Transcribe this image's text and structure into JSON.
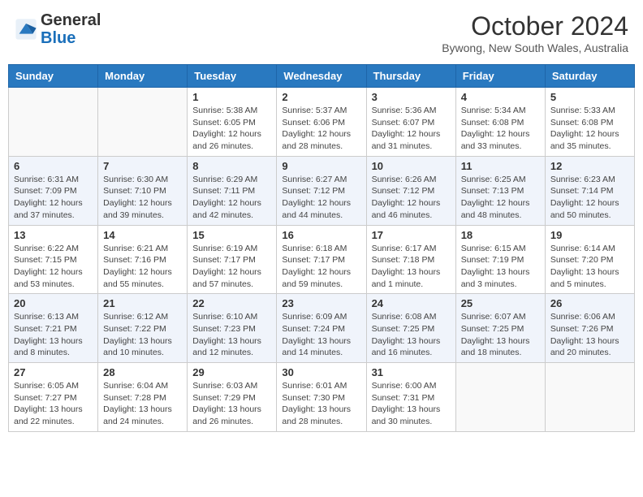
{
  "header": {
    "logo": {
      "general": "General",
      "blue": "Blue"
    },
    "title": "October 2024",
    "subtitle": "Bywong, New South Wales, Australia"
  },
  "days_of_week": [
    "Sunday",
    "Monday",
    "Tuesday",
    "Wednesday",
    "Thursday",
    "Friday",
    "Saturday"
  ],
  "weeks": [
    [
      {
        "day": "",
        "info": ""
      },
      {
        "day": "",
        "info": ""
      },
      {
        "day": "1",
        "sunrise": "Sunrise: 5:38 AM",
        "sunset": "Sunset: 6:05 PM",
        "daylight": "Daylight: 12 hours and 26 minutes."
      },
      {
        "day": "2",
        "sunrise": "Sunrise: 5:37 AM",
        "sunset": "Sunset: 6:06 PM",
        "daylight": "Daylight: 12 hours and 28 minutes."
      },
      {
        "day": "3",
        "sunrise": "Sunrise: 5:36 AM",
        "sunset": "Sunset: 6:07 PM",
        "daylight": "Daylight: 12 hours and 31 minutes."
      },
      {
        "day": "4",
        "sunrise": "Sunrise: 5:34 AM",
        "sunset": "Sunset: 6:08 PM",
        "daylight": "Daylight: 12 hours and 33 minutes."
      },
      {
        "day": "5",
        "sunrise": "Sunrise: 5:33 AM",
        "sunset": "Sunset: 6:08 PM",
        "daylight": "Daylight: 12 hours and 35 minutes."
      }
    ],
    [
      {
        "day": "6",
        "sunrise": "Sunrise: 6:31 AM",
        "sunset": "Sunset: 7:09 PM",
        "daylight": "Daylight: 12 hours and 37 minutes."
      },
      {
        "day": "7",
        "sunrise": "Sunrise: 6:30 AM",
        "sunset": "Sunset: 7:10 PM",
        "daylight": "Daylight: 12 hours and 39 minutes."
      },
      {
        "day": "8",
        "sunrise": "Sunrise: 6:29 AM",
        "sunset": "Sunset: 7:11 PM",
        "daylight": "Daylight: 12 hours and 42 minutes."
      },
      {
        "day": "9",
        "sunrise": "Sunrise: 6:27 AM",
        "sunset": "Sunset: 7:12 PM",
        "daylight": "Daylight: 12 hours and 44 minutes."
      },
      {
        "day": "10",
        "sunrise": "Sunrise: 6:26 AM",
        "sunset": "Sunset: 7:12 PM",
        "daylight": "Daylight: 12 hours and 46 minutes."
      },
      {
        "day": "11",
        "sunrise": "Sunrise: 6:25 AM",
        "sunset": "Sunset: 7:13 PM",
        "daylight": "Daylight: 12 hours and 48 minutes."
      },
      {
        "day": "12",
        "sunrise": "Sunrise: 6:23 AM",
        "sunset": "Sunset: 7:14 PM",
        "daylight": "Daylight: 12 hours and 50 minutes."
      }
    ],
    [
      {
        "day": "13",
        "sunrise": "Sunrise: 6:22 AM",
        "sunset": "Sunset: 7:15 PM",
        "daylight": "Daylight: 12 hours and 53 minutes."
      },
      {
        "day": "14",
        "sunrise": "Sunrise: 6:21 AM",
        "sunset": "Sunset: 7:16 PM",
        "daylight": "Daylight: 12 hours and 55 minutes."
      },
      {
        "day": "15",
        "sunrise": "Sunrise: 6:19 AM",
        "sunset": "Sunset: 7:17 PM",
        "daylight": "Daylight: 12 hours and 57 minutes."
      },
      {
        "day": "16",
        "sunrise": "Sunrise: 6:18 AM",
        "sunset": "Sunset: 7:17 PM",
        "daylight": "Daylight: 12 hours and 59 minutes."
      },
      {
        "day": "17",
        "sunrise": "Sunrise: 6:17 AM",
        "sunset": "Sunset: 7:18 PM",
        "daylight": "Daylight: 13 hours and 1 minute."
      },
      {
        "day": "18",
        "sunrise": "Sunrise: 6:15 AM",
        "sunset": "Sunset: 7:19 PM",
        "daylight": "Daylight: 13 hours and 3 minutes."
      },
      {
        "day": "19",
        "sunrise": "Sunrise: 6:14 AM",
        "sunset": "Sunset: 7:20 PM",
        "daylight": "Daylight: 13 hours and 5 minutes."
      }
    ],
    [
      {
        "day": "20",
        "sunrise": "Sunrise: 6:13 AM",
        "sunset": "Sunset: 7:21 PM",
        "daylight": "Daylight: 13 hours and 8 minutes."
      },
      {
        "day": "21",
        "sunrise": "Sunrise: 6:12 AM",
        "sunset": "Sunset: 7:22 PM",
        "daylight": "Daylight: 13 hours and 10 minutes."
      },
      {
        "day": "22",
        "sunrise": "Sunrise: 6:10 AM",
        "sunset": "Sunset: 7:23 PM",
        "daylight": "Daylight: 13 hours and 12 minutes."
      },
      {
        "day": "23",
        "sunrise": "Sunrise: 6:09 AM",
        "sunset": "Sunset: 7:24 PM",
        "daylight": "Daylight: 13 hours and 14 minutes."
      },
      {
        "day": "24",
        "sunrise": "Sunrise: 6:08 AM",
        "sunset": "Sunset: 7:25 PM",
        "daylight": "Daylight: 13 hours and 16 minutes."
      },
      {
        "day": "25",
        "sunrise": "Sunrise: 6:07 AM",
        "sunset": "Sunset: 7:25 PM",
        "daylight": "Daylight: 13 hours and 18 minutes."
      },
      {
        "day": "26",
        "sunrise": "Sunrise: 6:06 AM",
        "sunset": "Sunset: 7:26 PM",
        "daylight": "Daylight: 13 hours and 20 minutes."
      }
    ],
    [
      {
        "day": "27",
        "sunrise": "Sunrise: 6:05 AM",
        "sunset": "Sunset: 7:27 PM",
        "daylight": "Daylight: 13 hours and 22 minutes."
      },
      {
        "day": "28",
        "sunrise": "Sunrise: 6:04 AM",
        "sunset": "Sunset: 7:28 PM",
        "daylight": "Daylight: 13 hours and 24 minutes."
      },
      {
        "day": "29",
        "sunrise": "Sunrise: 6:03 AM",
        "sunset": "Sunset: 7:29 PM",
        "daylight": "Daylight: 13 hours and 26 minutes."
      },
      {
        "day": "30",
        "sunrise": "Sunrise: 6:01 AM",
        "sunset": "Sunset: 7:30 PM",
        "daylight": "Daylight: 13 hours and 28 minutes."
      },
      {
        "day": "31",
        "sunrise": "Sunrise: 6:00 AM",
        "sunset": "Sunset: 7:31 PM",
        "daylight": "Daylight: 13 hours and 30 minutes."
      },
      {
        "day": "",
        "info": ""
      },
      {
        "day": "",
        "info": ""
      }
    ]
  ]
}
